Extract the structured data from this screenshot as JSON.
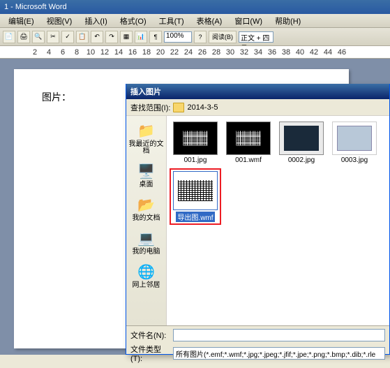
{
  "app_title": "1 - Microsoft Word",
  "menu": [
    "编辑(E)",
    "视图(V)",
    "插入(I)",
    "格式(O)",
    "工具(T)",
    "表格(A)",
    "窗口(W)",
    "帮助(H)"
  ],
  "toolbar": {
    "zoom": "100%",
    "style": "正文 + 四号",
    "read_label": "阅读(B)"
  },
  "ruler_numbers": [
    2,
    4,
    6,
    8,
    10,
    12,
    14,
    16,
    18,
    20,
    22,
    24,
    26,
    28,
    30,
    32,
    34,
    36,
    38,
    40,
    42,
    44,
    46
  ],
  "page": {
    "text": "图片："
  },
  "dialog": {
    "title": "插入图片",
    "lookin_label": "查找范围(I):",
    "lookin_value": "2014-3-5",
    "sidebar": [
      {
        "icon": "📁",
        "label": "我最近的文档"
      },
      {
        "icon": "🖥️",
        "label": "桌面"
      },
      {
        "icon": "📂",
        "label": "我的文档"
      },
      {
        "icon": "💻",
        "label": "我的电脑"
      },
      {
        "icon": "🌐",
        "label": "网上邻居"
      }
    ],
    "files": [
      {
        "name": "001.jpg",
        "thumb": "dark"
      },
      {
        "name": "001.wmf",
        "thumb": "dark"
      },
      {
        "name": "0002.jpg",
        "thumb": "light"
      },
      {
        "name": "0003.jpg",
        "thumb": "white"
      }
    ],
    "selected_file": {
      "name": "导出图.wmf"
    },
    "filename_label": "文件名(N):",
    "filetype_label": "文件类型(T):",
    "filetype_value": "所有图片(*.emf;*.wmf;*.jpg;*.jpeg;*.jfif;*.jpe;*.png;*.bmp;*.dib;*.rle"
  }
}
